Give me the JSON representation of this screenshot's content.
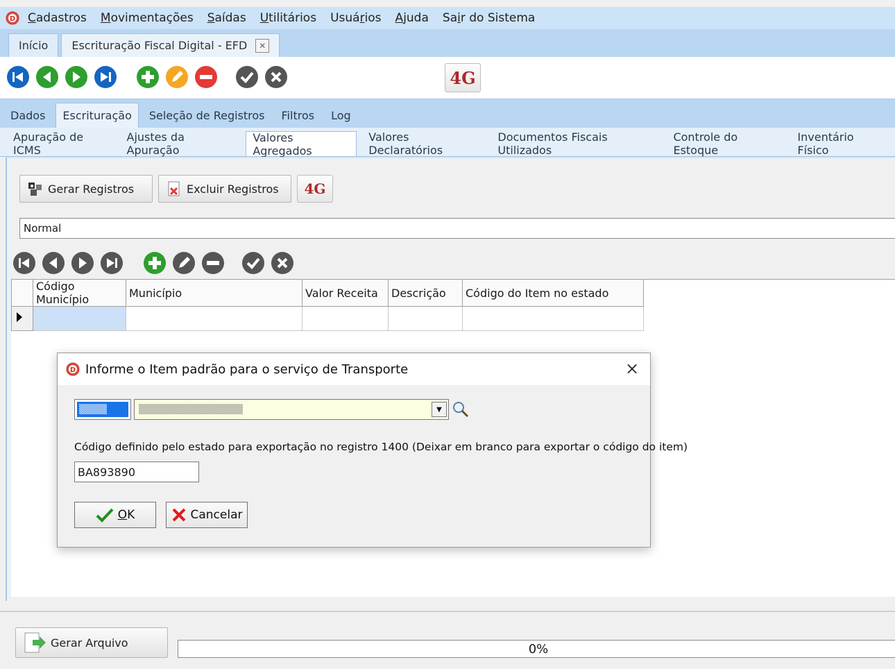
{
  "menubar": {
    "items": [
      {
        "prefix": "",
        "accel": "C",
        "rest": "adastros"
      },
      {
        "prefix": "",
        "accel": "M",
        "rest": "ovimentações"
      },
      {
        "prefix": "",
        "accel": "S",
        "rest": "aídas"
      },
      {
        "prefix": "",
        "accel": "U",
        "rest": "tilitários"
      },
      {
        "prefix": "Usuá",
        "accel": "r",
        "rest": "ios"
      },
      {
        "prefix": "",
        "accel": "A",
        "rest": "juda"
      },
      {
        "prefix": "Sa",
        "accel": "i",
        "rest": "r do Sistema"
      }
    ]
  },
  "toptabs": {
    "home": "Início",
    "efd": "Escrituração Fiscal Digital - EFD"
  },
  "sectabs": [
    "Dados",
    "Escrituração",
    "Seleção de Registros",
    "Filtros",
    "Log"
  ],
  "subtabs": [
    "Apuração de ICMS",
    "Ajustes da Apuração",
    "Valores Agregados",
    "Valores Declaratórios",
    "Documentos Fiscais Utilizados",
    "Controle do Estoque",
    "Inventário Físico"
  ],
  "actions": {
    "gerar": "Gerar Registros",
    "excluir": "Excluir Registros"
  },
  "combo_normal": "Normal",
  "grid": {
    "columns": [
      "Código Município",
      "Município",
      "Valor Receita",
      "Descrição",
      "Código do Item no estado"
    ]
  },
  "bottom": {
    "gerar_arquivo": "Gerar Arquivo",
    "progress_label": "0%",
    "progress_value": 0
  },
  "dialog": {
    "title": "Informe o Item padrão para o serviço de Transporte",
    "label": "Código definido pelo estado para exportação no registro 1400 (Deixar em branco para exportar o código do item)",
    "code_value": "BA893890",
    "ok_accel": "O",
    "ok_rest": "K",
    "cancel": "Cancelar"
  },
  "colors": {
    "accent": "#1a73e8",
    "nav_blue": "#1565c0",
    "nav_green": "#2e9e2e",
    "edit_orange": "#f5a623",
    "delete_red": "#e53935",
    "gray_dark": "#555555"
  }
}
